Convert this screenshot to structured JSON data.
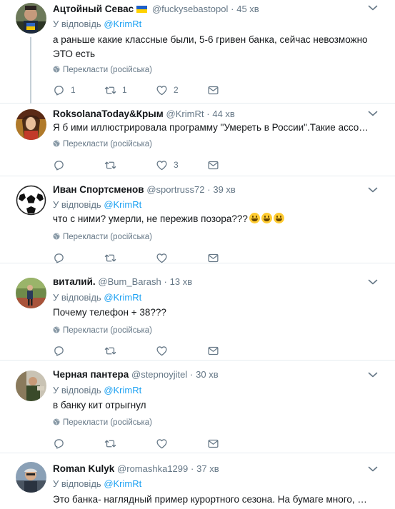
{
  "tweets": [
    {
      "name": "Ацтойный Севас",
      "handle": "@fuckysebastopol",
      "time": "45 хв",
      "reply_prefix": "У відповідь",
      "reply_to": "@KrimRt",
      "text": "а раньше какие классные были, 5-6 гривен банка, сейчас невозможно ЭТО есть",
      "translate": "Перекласти (російська)",
      "replies": "1",
      "retweets": "1",
      "likes": "2"
    },
    {
      "name": "RoksolanaToday&Крым",
      "handle": "@KrimRt",
      "time": "44 хв",
      "text": "Я б ими иллюстрировала программу \"Умереть в России\".Такие ассоциации..",
      "translate": "Перекласти (російська)",
      "replies": "",
      "retweets": "",
      "likes": "3"
    },
    {
      "name": "Иван Спортсменов",
      "handle": "@sportruss72",
      "time": "39 хв",
      "reply_prefix": "У відповідь",
      "reply_to": "@KrimRt",
      "text": "что с ними? умерли, не пережив позора???",
      "translate": "Перекласти (російська)",
      "replies": "",
      "retweets": "",
      "likes": ""
    },
    {
      "name": "виталий.",
      "handle": "@Bum_Barash",
      "time": "13 хв",
      "reply_prefix": "У відповідь",
      "reply_to": "@KrimRt",
      "text": "Почему телефон + 38???",
      "translate": "Перекласти (російська)",
      "replies": "",
      "retweets": "",
      "likes": ""
    },
    {
      "name": "Черная пантера",
      "handle": "@stepnoyjitel",
      "time": "30 хв",
      "reply_prefix": "У відповідь",
      "reply_to": "@KrimRt",
      "text": "в банку кит отрыгнул",
      "translate": "Перекласти (російська)",
      "replies": "",
      "retweets": "",
      "likes": ""
    },
    {
      "name": "Roman Kulyk",
      "handle": "@romashka1299",
      "time": "37 хв",
      "reply_prefix": "У відповідь",
      "reply_to": "@KrimRt",
      "text": "Это банка- наглядный пример курортного сезона. На бумаге много, на деле..."
    }
  ],
  "separator": "·",
  "icons": {
    "flag": "ukraine-flag-icon",
    "menu": "chevron-down-icon",
    "translate": "globe-icon",
    "reply": "reply-icon",
    "retweet": "retweet-icon",
    "like": "heart-icon",
    "dm": "envelope-icon",
    "emoji": "grinning-face-emoji"
  },
  "colors": {
    "link": "#1da1f2",
    "secondary_text": "#657786",
    "border": "#e6ecf0",
    "thread_line": "#c4cfd6"
  }
}
